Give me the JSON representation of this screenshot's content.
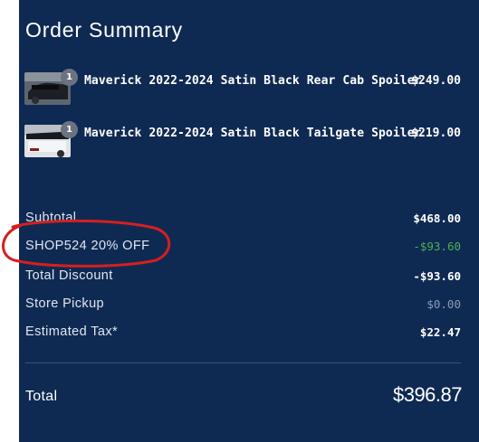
{
  "order_summary": {
    "title": "Order Summary",
    "items": [
      {
        "name": "Maverick 2022-2024 Satin Black Rear Cab Spoiler",
        "price": "$249.00",
        "quantity": "1"
      },
      {
        "name": "Maverick 2022-2024 Satin Black Tailgate Spoiler",
        "price": "$219.00",
        "quantity": "1"
      }
    ],
    "subtotal": {
      "label": "Subtotal",
      "value": "$468.00"
    },
    "promo": {
      "label": "SHOP524 20% OFF",
      "value": "-$93.60"
    },
    "total_discount": {
      "label": "Total Discount",
      "value": "-$93.60"
    },
    "store_pickup": {
      "label": "Store Pickup",
      "value": "$0.00"
    },
    "estimated_tax": {
      "label": "Estimated Tax*",
      "value": "$22.47"
    },
    "total": {
      "label": "Total",
      "value": "$396.87"
    }
  },
  "colors": {
    "panel_background": "#0f2a52",
    "discount_green": "#4caf50",
    "annotation_red": "#d61f1f"
  }
}
